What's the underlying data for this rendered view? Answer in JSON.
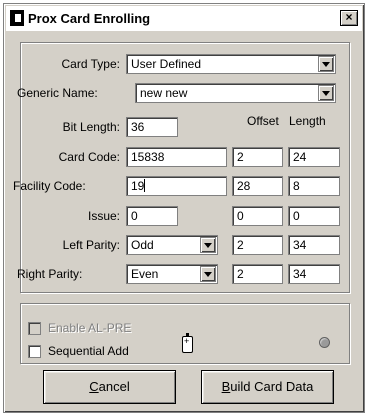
{
  "window": {
    "title": "Prox Card Enrolling",
    "close_glyph": "×"
  },
  "form": {
    "card_type": {
      "label": "Card Type:",
      "value": "User Defined"
    },
    "generic_name": {
      "label": "Generic Name:",
      "value": "new new"
    },
    "columns": {
      "offset": "Offset",
      "length": "Length"
    },
    "bit_length": {
      "label": "Bit Length:",
      "value": "36"
    },
    "card_code": {
      "label": "Card Code:",
      "value": "15838",
      "offset": "2",
      "length": "24"
    },
    "facility_code": {
      "label": "Facility Code:",
      "value": "19",
      "offset": "28",
      "length": "8"
    },
    "issue": {
      "label": "Issue:",
      "value": "0",
      "offset": "0",
      "length": "0"
    },
    "left_parity": {
      "label": "Left Parity:",
      "value": "Odd",
      "offset": "2",
      "length": "34"
    },
    "right_parity": {
      "label": "Right Parity:",
      "value": "Even",
      "offset": "2",
      "length": "34"
    }
  },
  "options": {
    "enable_al_pre": {
      "label": "Enable AL-PRE",
      "checked": false,
      "enabled": false
    },
    "sequential_add": {
      "label": "Sequential Add",
      "checked": false,
      "enabled": true
    }
  },
  "buttons": {
    "cancel": {
      "mnemonic": "C",
      "rest": "ancel"
    },
    "build_card_data": {
      "mnemonic": "B",
      "rest": "uild Card Data"
    }
  },
  "icons": {
    "app": "card-reader-icon",
    "battery": "battery-icon",
    "status_led": "status-led-icon"
  }
}
